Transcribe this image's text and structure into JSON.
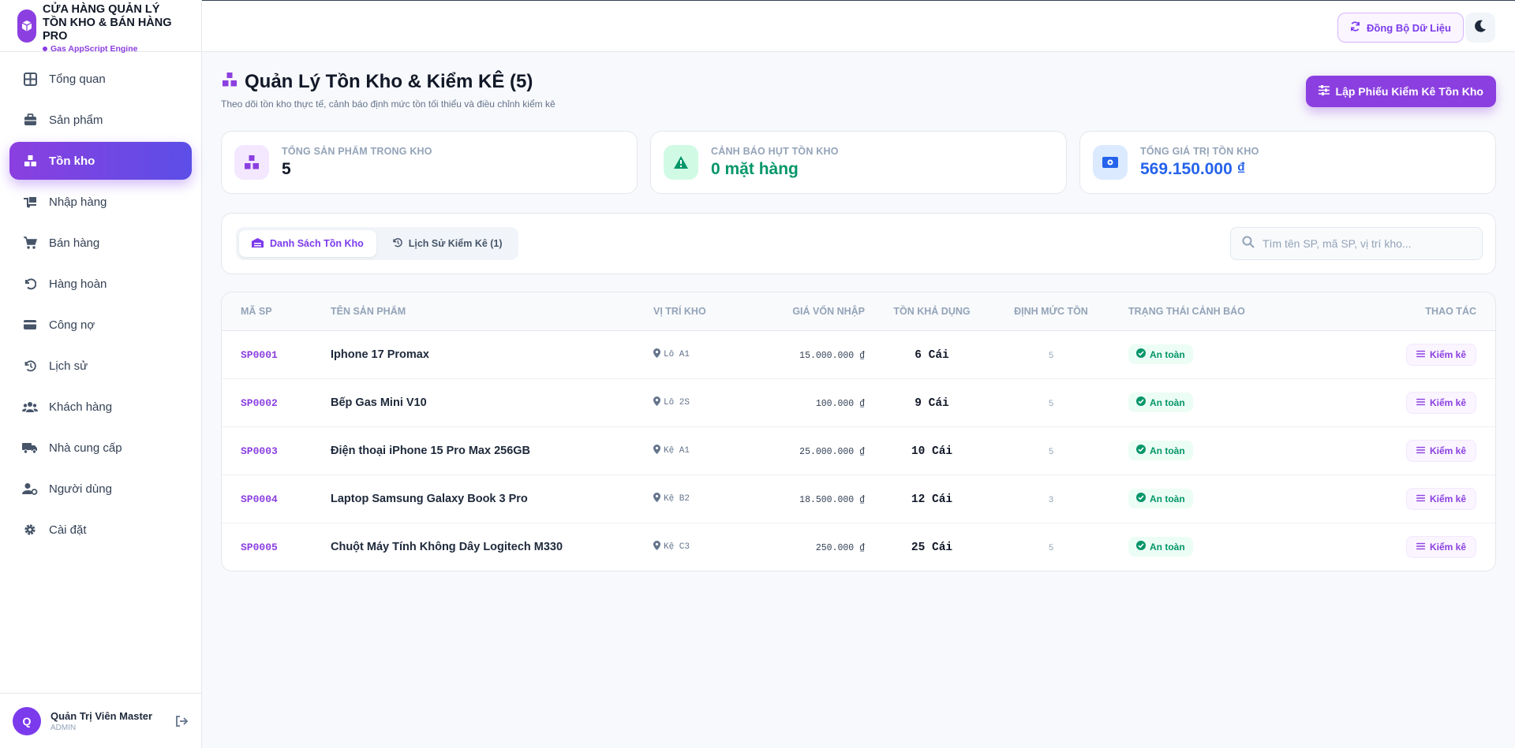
{
  "brand": {
    "title": "Cửa hàng quản lý tồn kho & bán hàng pro",
    "subtitle": "Gas AppScript Engine"
  },
  "sidebar": {
    "items": [
      {
        "label": "Tổng quan",
        "icon": "grid-icon"
      },
      {
        "label": "Sản phẩm",
        "icon": "briefcase-icon"
      },
      {
        "label": "Tồn kho",
        "icon": "boxes-icon",
        "active": true
      },
      {
        "label": "Nhập hàng",
        "icon": "truck-loading-icon"
      },
      {
        "label": "Bán hàng",
        "icon": "cart-icon"
      },
      {
        "label": "Hàng hoàn",
        "icon": "undo-icon"
      },
      {
        "label": "Công nợ",
        "icon": "credit-card-icon"
      },
      {
        "label": "Lịch sử",
        "icon": "history-icon"
      },
      {
        "label": "Khách hàng",
        "icon": "users-icon"
      },
      {
        "label": "Nhà cung cấp",
        "icon": "truck-icon"
      },
      {
        "label": "Người dùng",
        "icon": "user-gear-icon"
      },
      {
        "label": "Cài đặt",
        "icon": "gear-icon"
      }
    ]
  },
  "user": {
    "initial": "Q",
    "name": "Quản Trị Viên Master",
    "role": "ADMIN"
  },
  "topbar": {
    "sync_label": "Đồng Bộ Dữ Liệu"
  },
  "page": {
    "title": "Quản Lý Tồn Kho & Kiểm KÊ (5)",
    "subtitle": "Theo dõi tồn kho thực tế, cảnh báo định mức tồn tối thiểu và điều chỉnh kiểm kê",
    "primary_button": "Lập Phiếu Kiểm Kê Tồn Kho"
  },
  "stats": [
    {
      "label": "Tổng sản phẩm trong kho",
      "value": "5",
      "color": "#111827",
      "icon_bg": "#f3e8ff",
      "icon_color": "#8b3fe0"
    },
    {
      "label": "Cảnh báo hụt tồn kho",
      "value": "0 mặt hàng",
      "color": "#059669",
      "icon_bg": "#d1fae5",
      "icon_color": "#059669"
    },
    {
      "label": "Tổng giá trị tồn kho",
      "value": "569.150.000 ₫",
      "color": "#2563eb",
      "icon_bg": "#dbeafe",
      "icon_color": "#2563eb"
    }
  ],
  "tabs": [
    {
      "label": "Danh Sách Tồn Kho",
      "active": true
    },
    {
      "label": "Lịch Sử Kiểm Kê (1)",
      "active": false
    }
  ],
  "search": {
    "placeholder": "Tìm tên SP, mã SP, vị trí kho...",
    "value": ""
  },
  "table": {
    "headers": [
      "Mã SP",
      "Tên sản phẩm",
      "Vị trí kho",
      "Giá vốn nhập",
      "Tồn khả dụng",
      "Định mức tồn",
      "Trạng thái cảnh báo",
      "Thao tác"
    ],
    "rows": [
      {
        "code": "SP0001",
        "name": "Iphone 17 Promax",
        "location": "Lô A1",
        "cost": "15.000.000 ₫",
        "qty": "6 Cái",
        "min": "5",
        "status": "An toàn",
        "action": "Kiểm kê"
      },
      {
        "code": "SP0002",
        "name": "Bếp Gas Mini V10",
        "location": "Lô 2S",
        "cost": "100.000 ₫",
        "qty": "9 Cái",
        "min": "5",
        "status": "An toàn",
        "action": "Kiểm kê"
      },
      {
        "code": "SP0003",
        "name": "Điện thoại iPhone 15 Pro Max 256GB",
        "location": "Kệ A1",
        "cost": "25.000.000 ₫",
        "qty": "10 Cái",
        "min": "5",
        "status": "An toàn",
        "action": "Kiểm kê"
      },
      {
        "code": "SP0004",
        "name": "Laptop Samsung Galaxy Book 3 Pro",
        "location": "Kệ B2",
        "cost": "18.500.000 ₫",
        "qty": "12 Cái",
        "min": "3",
        "status": "An toàn",
        "action": "Kiểm kê"
      },
      {
        "code": "SP0005",
        "name": "Chuột Máy Tính Không Dây Logitech M330",
        "location": "Kệ C3",
        "cost": "250.000 ₫",
        "qty": "25 Cái",
        "min": "5",
        "status": "An toàn",
        "action": "Kiểm kê"
      }
    ]
  }
}
